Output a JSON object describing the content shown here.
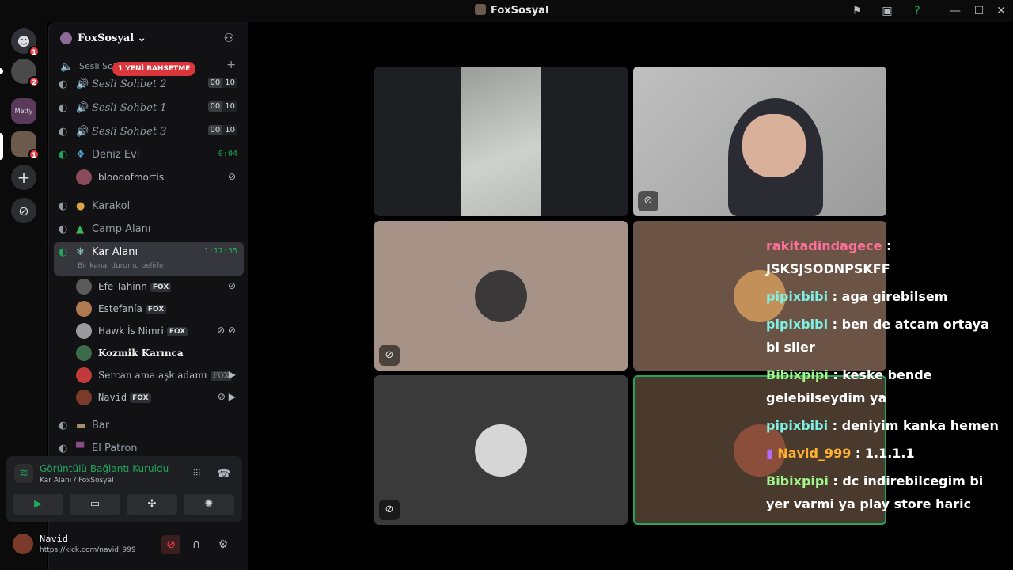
{
  "window": {
    "title": "FoxSosyal"
  },
  "titlebar": {
    "flag_icon": "flag-icon",
    "inbox_icon": "inbox-icon",
    "help_icon": "help-icon",
    "minimize": "—",
    "maximize": "☐",
    "close": "✕"
  },
  "servers": [
    {
      "name": "discord-home",
      "badge": "1"
    },
    {
      "name": "server-avatar-1",
      "badge": "2"
    },
    {
      "name": "server-metty",
      "badge": ""
    },
    {
      "name": "server-avatar-3",
      "badge": "1"
    }
  ],
  "guild": {
    "name": "FoxSosyal"
  },
  "mention_pill": "1 YENİ BAHSETME",
  "channels": {
    "top_cut": "Sesli Sohbet",
    "sesli2": {
      "name": "Sesli Sohbet 2",
      "a": "00",
      "b": "10"
    },
    "sesli1": {
      "name": "Sesli Sohbet 1",
      "a": "00",
      "b": "10"
    },
    "sesli3": {
      "name": "Sesli Sohbet 3",
      "a": "00",
      "b": "10"
    },
    "deniz": {
      "name": "Deniz Evi",
      "time": "0:04"
    },
    "karakol": {
      "name": "Karakol"
    },
    "camp": {
      "name": "Camp Alanı"
    },
    "kar": {
      "name": "Kar Alanı",
      "time": "1:17:35",
      "status": "Bir kanal durumu belirle"
    },
    "bar": {
      "name": "Bar"
    },
    "patron": {
      "name": "El Patron"
    }
  },
  "users": {
    "blood": "bloodofmortis",
    "efe": "Efe Tahinn",
    "estefania": "Estefanía",
    "hawk": "Hawk İs Nimri",
    "kozmik": "Kozmik Karınca",
    "sercan": "Sercan ama aşk adamı",
    "navid": "Navid",
    "tag": "FOX"
  },
  "voice_panel": {
    "title": "Görüntülü Bağlantı Kuruldu",
    "subtitle": "Kar Alanı / FoxSosyal"
  },
  "user_bar": {
    "name": "Navid",
    "status": "https://kick.com/navid_999"
  },
  "chat": [
    {
      "user": "rakitadindagece",
      "color": "#ff6f9a",
      "text": " : JSKSJSODNPSKFF"
    },
    {
      "user": "pipixbibi",
      "color": "#7ef0e4",
      "text": " : aga girebilsem"
    },
    {
      "user": "pipixbibi",
      "color": "#7ef0e4",
      "text": " : ben de atcam ortaya bi siler"
    },
    {
      "user": "Bibixpipi",
      "color": "#9ff58a",
      "text": " : keske bende gelebilseydim ya"
    },
    {
      "user": "pipixbibi",
      "color": "#7ef0e4",
      "text": " : deniyim kanka hemen"
    },
    {
      "user": "Navid_999",
      "color": "#ffb02e",
      "text": " : 1.1.1.1"
    },
    {
      "user": "Bibixpipi",
      "color": "#9ff58a",
      "text": " : dc indirebilcegim bi yer varmi ya play store haric"
    }
  ]
}
